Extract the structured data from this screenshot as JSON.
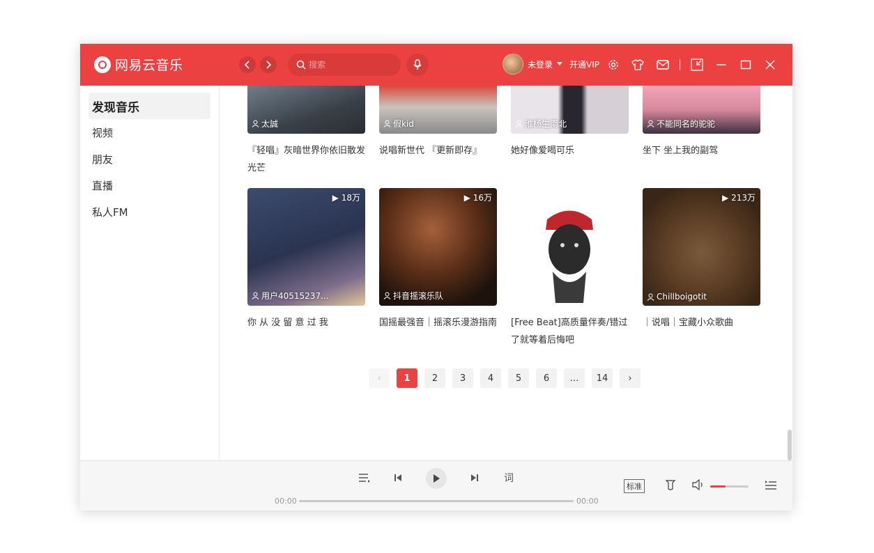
{
  "app": {
    "name": "网易云音乐",
    "search_placeholder": "搜索",
    "user_status": "未登录",
    "vip_label": "开通VIP"
  },
  "colors": {
    "brand": "#ec4141"
  },
  "sidebar": {
    "items": [
      {
        "label": "发现音乐",
        "active": true
      },
      {
        "label": "视频"
      },
      {
        "label": "朋友"
      },
      {
        "label": "直播"
      },
      {
        "label": "私人FM"
      }
    ]
  },
  "playlists_row1": [
    {
      "creator": "太誠",
      "title": "『轻唱』灰暗世界你依旧散发光芒"
    },
    {
      "creator": "假kid",
      "title": "说唱新世代 『更新即存』"
    },
    {
      "creator": "淮杨生南北",
      "title": "她好像爱喝可乐"
    },
    {
      "creator": "不能同名的驼驼",
      "title": "坐下 坐上我的副驾"
    }
  ],
  "playlists_row2": [
    {
      "plays": "18万",
      "creator": "用户40515237...",
      "title": "你 从 没 留 意 过 我"
    },
    {
      "plays": "16万",
      "creator": "抖音摇滚乐队",
      "title": "国摇最强音｜摇滚乐漫游指南"
    },
    {
      "plays": "",
      "creator": "",
      "title": "[Free Beat]高质量伴奏/错过了就等着后悔吧"
    },
    {
      "plays": "213万",
      "creator": "Chillboigotit",
      "title": "｜说唱｜宝藏小众歌曲"
    }
  ],
  "pagination": {
    "prev": "‹",
    "pages": [
      "1",
      "2",
      "3",
      "4",
      "5",
      "6",
      "…",
      "14"
    ],
    "current": "1",
    "next": "›"
  },
  "player": {
    "current_time": "00:00",
    "total_time": "00:00",
    "lyrics_label": "词",
    "quality_label": "标准",
    "volume": 0.4,
    "progress": 0
  }
}
